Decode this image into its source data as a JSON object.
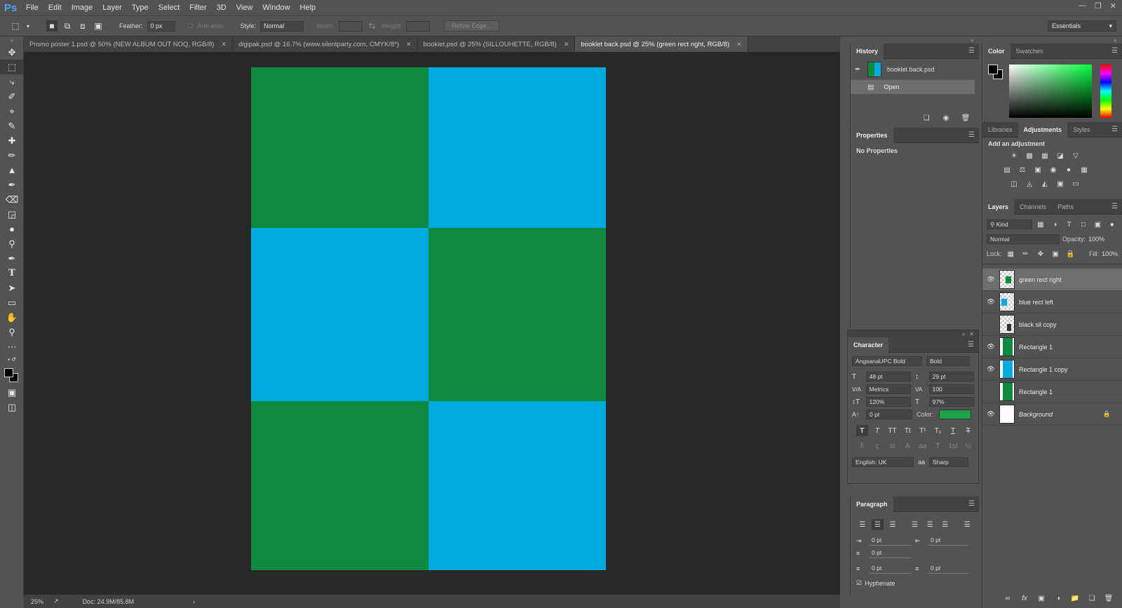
{
  "app": {
    "logo": "Ps",
    "menus": [
      "File",
      "Edit",
      "Image",
      "Layer",
      "Type",
      "Select",
      "Filter",
      "3D",
      "View",
      "Window",
      "Help"
    ]
  },
  "options": {
    "feather_label": "Feather:",
    "feather_value": "0 px",
    "antialias_label": "Anti-alias",
    "style_label": "Style:",
    "style_value": "Normal",
    "width_label": "Width:",
    "height_label": "Height:",
    "refine_edge": "Refine Edge...",
    "workspace": "Essentials"
  },
  "doc_tabs": [
    {
      "label": "Promo poster 1.psd @ 50% (NEW ALBUM OUT NOQ, RGB/8)"
    },
    {
      "label": "digipak.psd @ 16.7% (www.silentparty.com, CMYK/8*)"
    },
    {
      "label": "booklet.psd @ 25% (SILLOUHETTE, RGB/8)"
    },
    {
      "label": "booklet back.psd @ 25% (green rect right, RGB/8)"
    }
  ],
  "canvas_colors": {
    "green": "#0d8a3e",
    "blue": "#00a9e0"
  },
  "status": {
    "zoom": "25%",
    "doc": "Doc: 24.9M/85.8M"
  },
  "history": {
    "tab": "History",
    "items": [
      {
        "label": "booklet back.psd"
      },
      {
        "label": "Open"
      }
    ]
  },
  "properties": {
    "tab": "Properties",
    "message": "No Properties"
  },
  "character": {
    "tab": "Character",
    "font": "AngsanaUPC Bold",
    "style": "Bold",
    "size": "48 pt",
    "leading": "29 pt",
    "kerning": "Metrics",
    "tracking": "100",
    "vscale": "120%",
    "hscale": "97%",
    "baseline": "0 pt",
    "color_label": "Color:",
    "color": "#1aa34a",
    "language": "English: UK",
    "aa": "Sharp"
  },
  "paragraph": {
    "tab": "Paragraph",
    "indent_left": "0 pt",
    "indent_right": "0 pt",
    "indent_first": "0 pt",
    "space_before": "0 pt",
    "space_after": "0 pt",
    "hyphenate": "Hyphenate"
  },
  "color_panel": {
    "tabs": [
      "Color",
      "Swatches"
    ]
  },
  "adjust_panel": {
    "tabs": [
      "Libraries",
      "Adjustments",
      "Styles"
    ],
    "hint": "Add an adjustment"
  },
  "layers_panel": {
    "tabs": [
      "Layers",
      "Channels",
      "Paths"
    ],
    "filter": "Kind",
    "blend": "Normal",
    "opacity_label": "Opacity:",
    "opacity": "100%",
    "lock_label": "Lock:",
    "fill_label": "Fill:",
    "fill": "100%",
    "layers": [
      {
        "name": "green rect right",
        "visible": true,
        "selected": true
      },
      {
        "name": "blue rect left",
        "visible": true
      },
      {
        "name": "black sil copy",
        "visible": false
      },
      {
        "name": "Rectangle 1",
        "visible": true
      },
      {
        "name": "Rectangle 1 copy",
        "visible": true
      },
      {
        "name": "Rectangle 1",
        "visible": false
      },
      {
        "name": "Background",
        "visible": true,
        "locked": true
      }
    ]
  }
}
